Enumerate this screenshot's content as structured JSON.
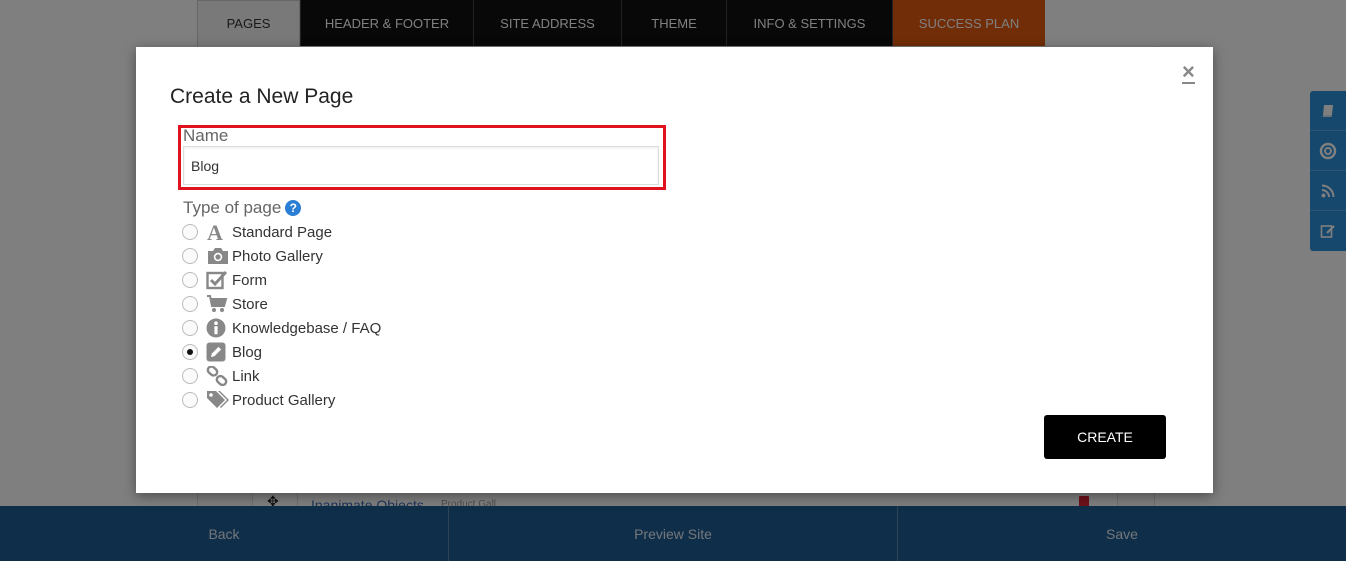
{
  "tabs": [
    {
      "label": "PAGES"
    },
    {
      "label": "HEADER & FOOTER"
    },
    {
      "label": "SITE ADDRESS"
    },
    {
      "label": "THEME"
    },
    {
      "label": "INFO & SETTINGS"
    },
    {
      "label": "SUCCESS PLAN"
    }
  ],
  "background_row": {
    "link": "Inanimate Objects",
    "type": "Product Gall..."
  },
  "bottom_bar": {
    "back": "Back",
    "preview": "Preview Site",
    "save": "Save"
  },
  "side_tools": [
    "book-icon",
    "lifebuoy-icon",
    "rss-icon",
    "edit-icon"
  ],
  "modal": {
    "title": "Create a New Page",
    "close": "×",
    "name_label": "Name",
    "name_value": "Blog",
    "type_label": "Type of page",
    "help": "?",
    "page_types": [
      {
        "label": "Standard Page",
        "icon": "font-a-icon",
        "checked": false
      },
      {
        "label": "Photo Gallery",
        "icon": "camera-icon",
        "checked": false
      },
      {
        "label": "Form",
        "icon": "checkbox-icon",
        "checked": false
      },
      {
        "label": "Store",
        "icon": "cart-icon",
        "checked": false
      },
      {
        "label": "Knowledgebase / FAQ",
        "icon": "info-icon",
        "checked": false
      },
      {
        "label": "Blog",
        "icon": "pencil-square-icon",
        "checked": true
      },
      {
        "label": "Link",
        "icon": "link-icon",
        "checked": false
      },
      {
        "label": "Product Gallery",
        "icon": "tags-icon",
        "checked": false
      }
    ],
    "create_label": "CREATE"
  },
  "colors": {
    "tab_dark": "#111111",
    "tab_success": "#e35b0f",
    "bottom_bar": "#1f5d92",
    "side_tools": "#2c8ed9",
    "highlight": "#e0121d",
    "help_icon": "#2a7fd4"
  }
}
